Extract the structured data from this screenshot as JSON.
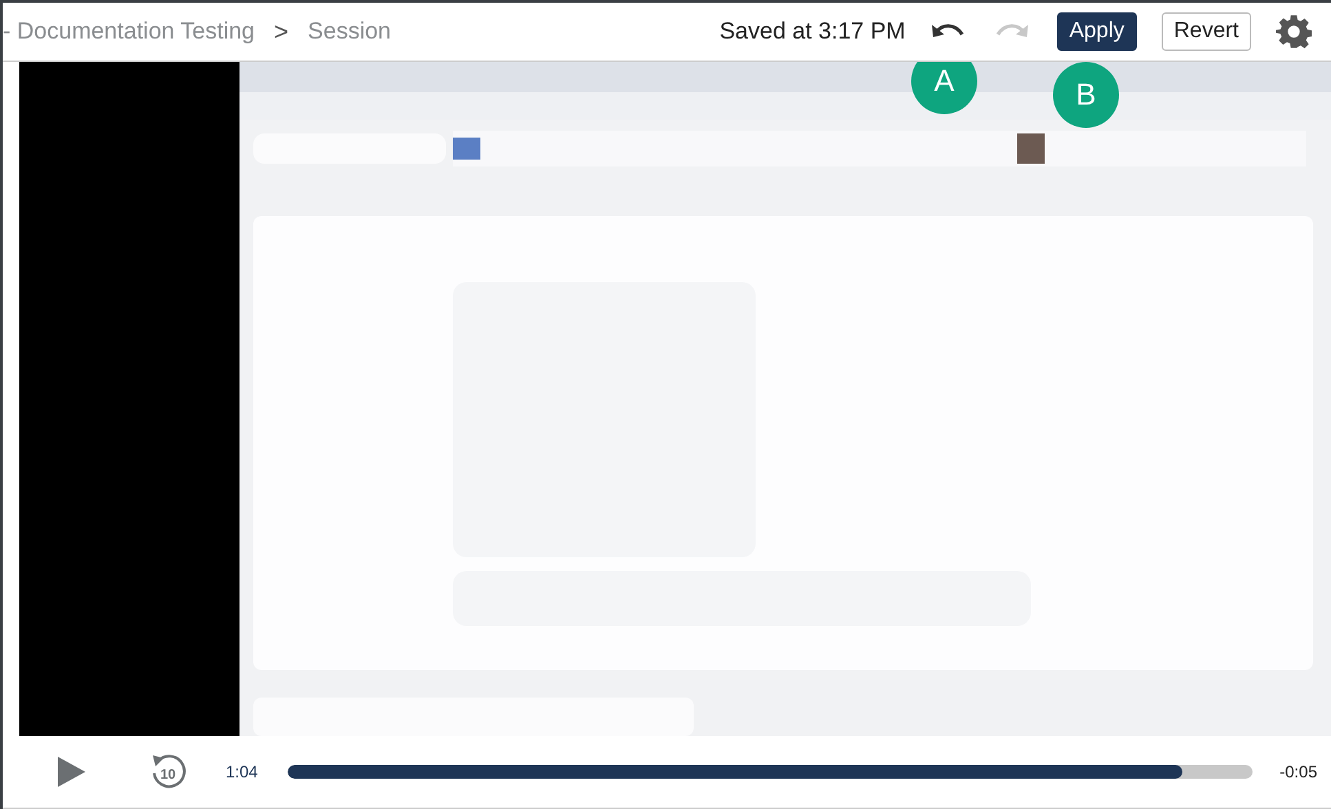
{
  "toolbar": {
    "breadcrumb": [
      {
        "label": "- Documentation Testing"
      },
      {
        "label": "Session"
      }
    ],
    "separator": ">",
    "saved_status": "Saved at 3:17 PM",
    "undo": {
      "disabled": false
    },
    "redo": {
      "disabled": true
    },
    "buttons": [
      {
        "label": "Apply",
        "kind": "primary"
      },
      {
        "label": "Revert",
        "kind": "secondary"
      }
    ]
  },
  "callouts": [
    {
      "label": "A"
    },
    {
      "label": "B"
    }
  ],
  "player": {
    "replay_label": "10",
    "elapsed": "1:04",
    "progress": {
      "level": 0.927
    },
    "remaining": "-0:05"
  }
}
